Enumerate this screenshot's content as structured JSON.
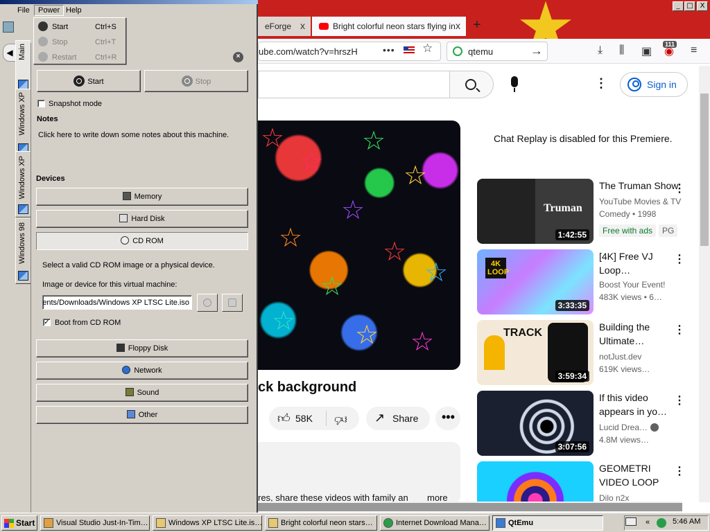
{
  "firefox": {
    "window_controls": [
      "_",
      "□",
      "X"
    ],
    "tabs": [
      {
        "label": "eForge",
        "close": "x"
      },
      {
        "label": "Bright colorful neon stars flying in",
        "close": "x"
      }
    ],
    "new_tab": "+",
    "url": "ube.com/watch?v=hrszH",
    "url_menu": "•••",
    "search_value": "qtemu",
    "badge": "111",
    "icons": [
      "download-icon",
      "library-icon",
      "sidebar-icon",
      "extension-icon",
      "menu-icon"
    ]
  },
  "youtube": {
    "sign_in": "Sign in",
    "video_title_partial": "ck background",
    "likes": "58K",
    "share": "Share",
    "more": "•••",
    "desc_partial": "res, share these videos with family an",
    "desc_more": "more",
    "chat_notice": "Chat Replay is disabled for this Premiere.",
    "recs": [
      {
        "title": "The Truman Show",
        "channel": "YouTube Movies & TV",
        "meta": "Comedy • 1998",
        "tags": [
          "Free with ads",
          "PG"
        ],
        "duration": "1:42:55",
        "thumb_text": "Truman"
      },
      {
        "title": "[4K] Free VJ Loop…",
        "channel": "Boost Your Event!",
        "meta": "483K views  • 6…",
        "duration": "3:33:35",
        "thumb_text": "4K LOOP"
      },
      {
        "title": "Building the Ultimate…",
        "channel": "notJust.dev",
        "meta": "619K views…",
        "duration": "3:59:34",
        "thumb_text": "TRACK"
      },
      {
        "title": "If this video appears in yo…",
        "channel": "Lucid Drea…",
        "meta": "4.8M views…",
        "duration": "3:07:56"
      },
      {
        "title": "GEOMETRI VIDEO LOOP",
        "channel": "Dilo n2x",
        "meta": ""
      }
    ]
  },
  "qtemu": {
    "menu": [
      "File",
      "Power",
      "Help"
    ],
    "power_menu": [
      {
        "label": "Start",
        "shortcut": "Ctrl+S",
        "enabled": true
      },
      {
        "label": "Stop",
        "shortcut": "Ctrl+T",
        "enabled": false
      },
      {
        "label": "Restart",
        "shortcut": "Ctrl+R",
        "enabled": false
      }
    ],
    "side_tabs": [
      "Main",
      "Windows XP",
      "Windows XP",
      "Windows 98"
    ],
    "start_label": "Start",
    "stop_label": "Stop",
    "snapshot_label": "Snapshot mode",
    "snapshot_checked": false,
    "notes_heading": "Notes",
    "notes_placeholder": "Click here to write down some notes about this machine.",
    "devices_heading": "Devices",
    "devices": [
      "Memory",
      "Hard Disk",
      "CD ROM"
    ],
    "cdrom_hint": "Select a valid CD ROM image or a physical device.",
    "image_label": "Image or device for this virtual machine:",
    "image_value": "ments/Downloads/Windows XP LTSC Lite.iso",
    "boot_cdrom_label": "Boot from CD ROM",
    "boot_cdrom_checked": true,
    "check_mark": "✓",
    "close_glyph": "×",
    "devices_more": [
      "Floppy Disk",
      "Network",
      "Sound",
      "Other"
    ]
  },
  "taskbar": {
    "start": "Start",
    "buttons": [
      {
        "label": "Visual Studio Just-In-Tim…",
        "active": false
      },
      {
        "label": "Windows XP LTSC Lite.is…",
        "active": false
      },
      {
        "label": "Bright colorful neon stars…",
        "active": false
      },
      {
        "label": "Internet Download Mana…",
        "active": false
      },
      {
        "label": "QtEmu",
        "active": true
      }
    ],
    "tray_chevron": "«",
    "clock": "5:46 AM"
  },
  "colors": {
    "win_face": "#d4d0c8",
    "tab_red": "#c8211d",
    "yt_blue": "#065fd4"
  }
}
